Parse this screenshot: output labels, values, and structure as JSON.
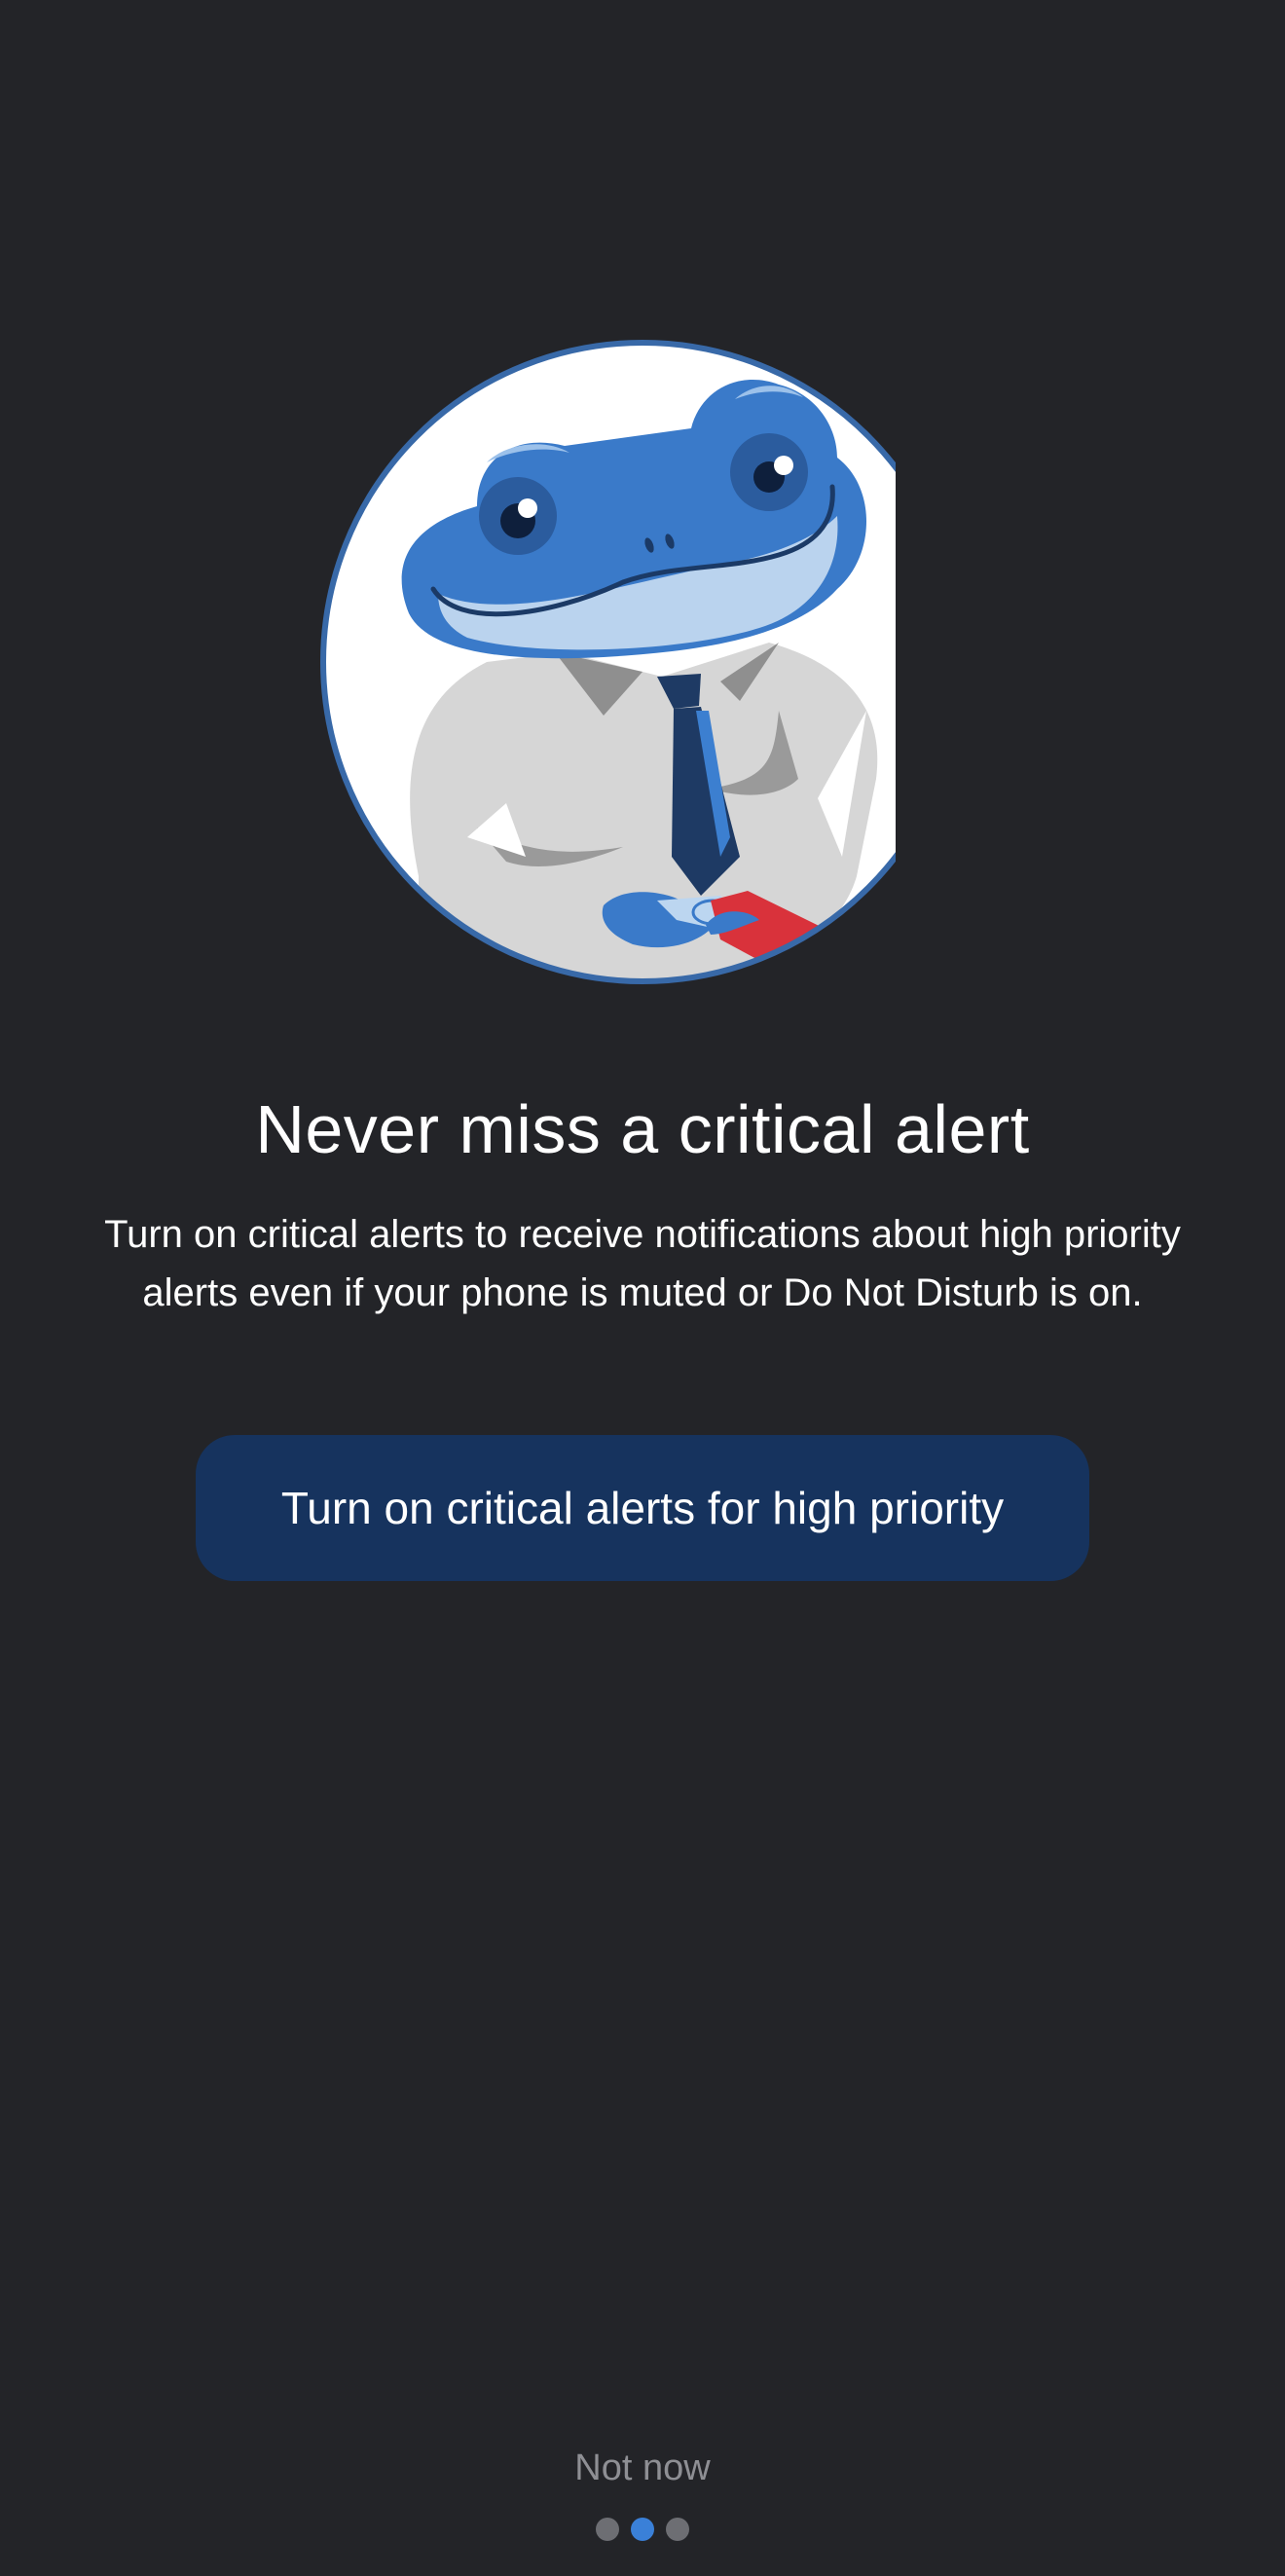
{
  "onboarding": {
    "title": "Never miss a critical alert",
    "description": "Turn on critical alerts to receive notifications about high priority alerts even if your phone is muted or Do Not Disturb is on.",
    "primary_button_label": "Turn on critical alerts for high priority",
    "secondary_button_label": "Not now",
    "illustration_icon": "frog-mascot-illustration"
  },
  "pager": {
    "total_pages": 3,
    "current_page": 2
  },
  "colors": {
    "background": "#232428",
    "primary_button": "#16335e",
    "active_dot": "#3a80d8",
    "inactive_dot": "#6d6e73",
    "secondary_text": "#8e8f94"
  }
}
